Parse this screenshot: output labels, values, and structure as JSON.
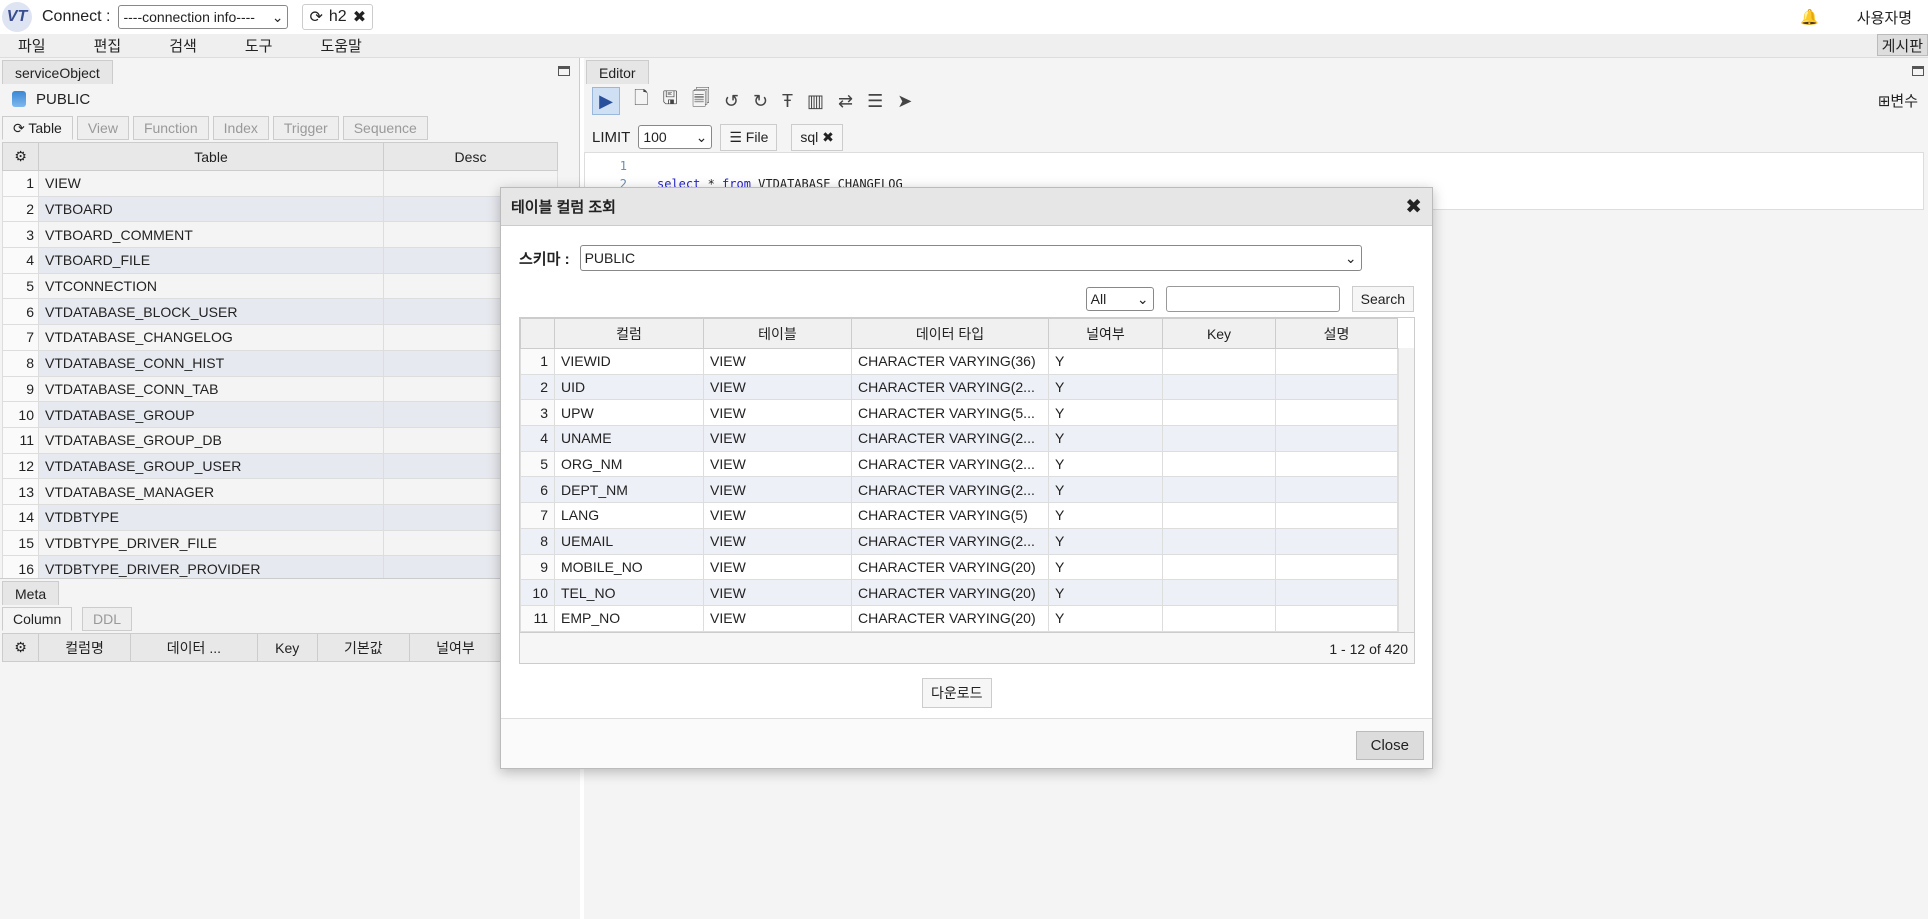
{
  "topbar": {
    "logo": "VT",
    "connect_label": "Connect :",
    "connection_select": "----connection info----",
    "tab_label": "h2",
    "user_name": "사용자명"
  },
  "menu": {
    "items": [
      "파일",
      "편집",
      "검색",
      "도구",
      "도움말"
    ],
    "board": "게시판"
  },
  "left_panel": {
    "panel_title": "serviceObject",
    "schema": "PUBLIC",
    "tabs": [
      "Table",
      "View",
      "Function",
      "Index",
      "Trigger",
      "Sequence"
    ],
    "columns": [
      "Table",
      "Desc"
    ],
    "rows": [
      {
        "n": "1",
        "name": "VIEW"
      },
      {
        "n": "2",
        "name": "VTBOARD"
      },
      {
        "n": "3",
        "name": "VTBOARD_COMMENT"
      },
      {
        "n": "4",
        "name": "VTBOARD_FILE"
      },
      {
        "n": "5",
        "name": "VTCONNECTION"
      },
      {
        "n": "6",
        "name": "VTDATABASE_BLOCK_USER"
      },
      {
        "n": "7",
        "name": "VTDATABASE_CHANGELOG"
      },
      {
        "n": "8",
        "name": "VTDATABASE_CONN_HIST"
      },
      {
        "n": "9",
        "name": "VTDATABASE_CONN_TAB"
      },
      {
        "n": "10",
        "name": "VTDATABASE_GROUP"
      },
      {
        "n": "11",
        "name": "VTDATABASE_GROUP_DB"
      },
      {
        "n": "12",
        "name": "VTDATABASE_GROUP_USER"
      },
      {
        "n": "13",
        "name": "VTDATABASE_MANAGER"
      },
      {
        "n": "14",
        "name": "VTDBTYPE"
      },
      {
        "n": "15",
        "name": "VTDBTYPE_DRIVER_FILE"
      },
      {
        "n": "16",
        "name": "VTDBTYPE_DRIVER_PROVIDER"
      }
    ],
    "meta_title": "Meta",
    "meta_tabs": [
      "Column",
      "DDL"
    ],
    "meta_columns": [
      "컬럼명",
      "데이터 ...",
      "Key",
      "기본값",
      "널여부"
    ]
  },
  "editor": {
    "title": "Editor",
    "vars_label": "⊞변수",
    "limit_label": "LIMIT",
    "limit_value": "100",
    "file_label": "File",
    "sql_tab": "sql",
    "line1": "1",
    "line2": "2",
    "code_kw1": "select",
    "code_star": " * ",
    "code_kw2": "from",
    "code_rest": " VTDATABASE_CHANGELOG"
  },
  "modal": {
    "title": "테이블 컬럼 조회",
    "schema_label": "스키마 :",
    "schema_value": "PUBLIC",
    "filter_value": "All",
    "search_placeholder": "",
    "search_button": "Search",
    "columns": [
      "컬럼",
      "테이블",
      "데이터 타입",
      "널여부",
      "Key",
      "설명"
    ],
    "rows": [
      {
        "n": "1",
        "col": "VIEWID",
        "tbl": "VIEW",
        "type": "CHARACTER VARYING(36)",
        "nul": "Y",
        "key": "",
        "desc": ""
      },
      {
        "n": "2",
        "col": "UID",
        "tbl": "VIEW",
        "type": "CHARACTER VARYING(2...",
        "nul": "Y",
        "key": "",
        "desc": ""
      },
      {
        "n": "3",
        "col": "UPW",
        "tbl": "VIEW",
        "type": "CHARACTER VARYING(5...",
        "nul": "Y",
        "key": "",
        "desc": ""
      },
      {
        "n": "4",
        "col": "UNAME",
        "tbl": "VIEW",
        "type": "CHARACTER VARYING(2...",
        "nul": "Y",
        "key": "",
        "desc": ""
      },
      {
        "n": "5",
        "col": "ORG_NM",
        "tbl": "VIEW",
        "type": "CHARACTER VARYING(2...",
        "nul": "Y",
        "key": "",
        "desc": ""
      },
      {
        "n": "6",
        "col": "DEPT_NM",
        "tbl": "VIEW",
        "type": "CHARACTER VARYING(2...",
        "nul": "Y",
        "key": "",
        "desc": ""
      },
      {
        "n": "7",
        "col": "LANG",
        "tbl": "VIEW",
        "type": "CHARACTER VARYING(5)",
        "nul": "Y",
        "key": "",
        "desc": ""
      },
      {
        "n": "8",
        "col": "UEMAIL",
        "tbl": "VIEW",
        "type": "CHARACTER VARYING(2...",
        "nul": "Y",
        "key": "",
        "desc": ""
      },
      {
        "n": "9",
        "col": "MOBILE_NO",
        "tbl": "VIEW",
        "type": "CHARACTER VARYING(20)",
        "nul": "Y",
        "key": "",
        "desc": ""
      },
      {
        "n": "10",
        "col": "TEL_NO",
        "tbl": "VIEW",
        "type": "CHARACTER VARYING(20)",
        "nul": "Y",
        "key": "",
        "desc": ""
      },
      {
        "n": "11",
        "col": "EMP_NO",
        "tbl": "VIEW",
        "type": "CHARACTER VARYING(20)",
        "nul": "Y",
        "key": "",
        "desc": ""
      }
    ],
    "pager": "1 - 12 of 420",
    "download_button": "다운로드",
    "close_button": "Close"
  }
}
